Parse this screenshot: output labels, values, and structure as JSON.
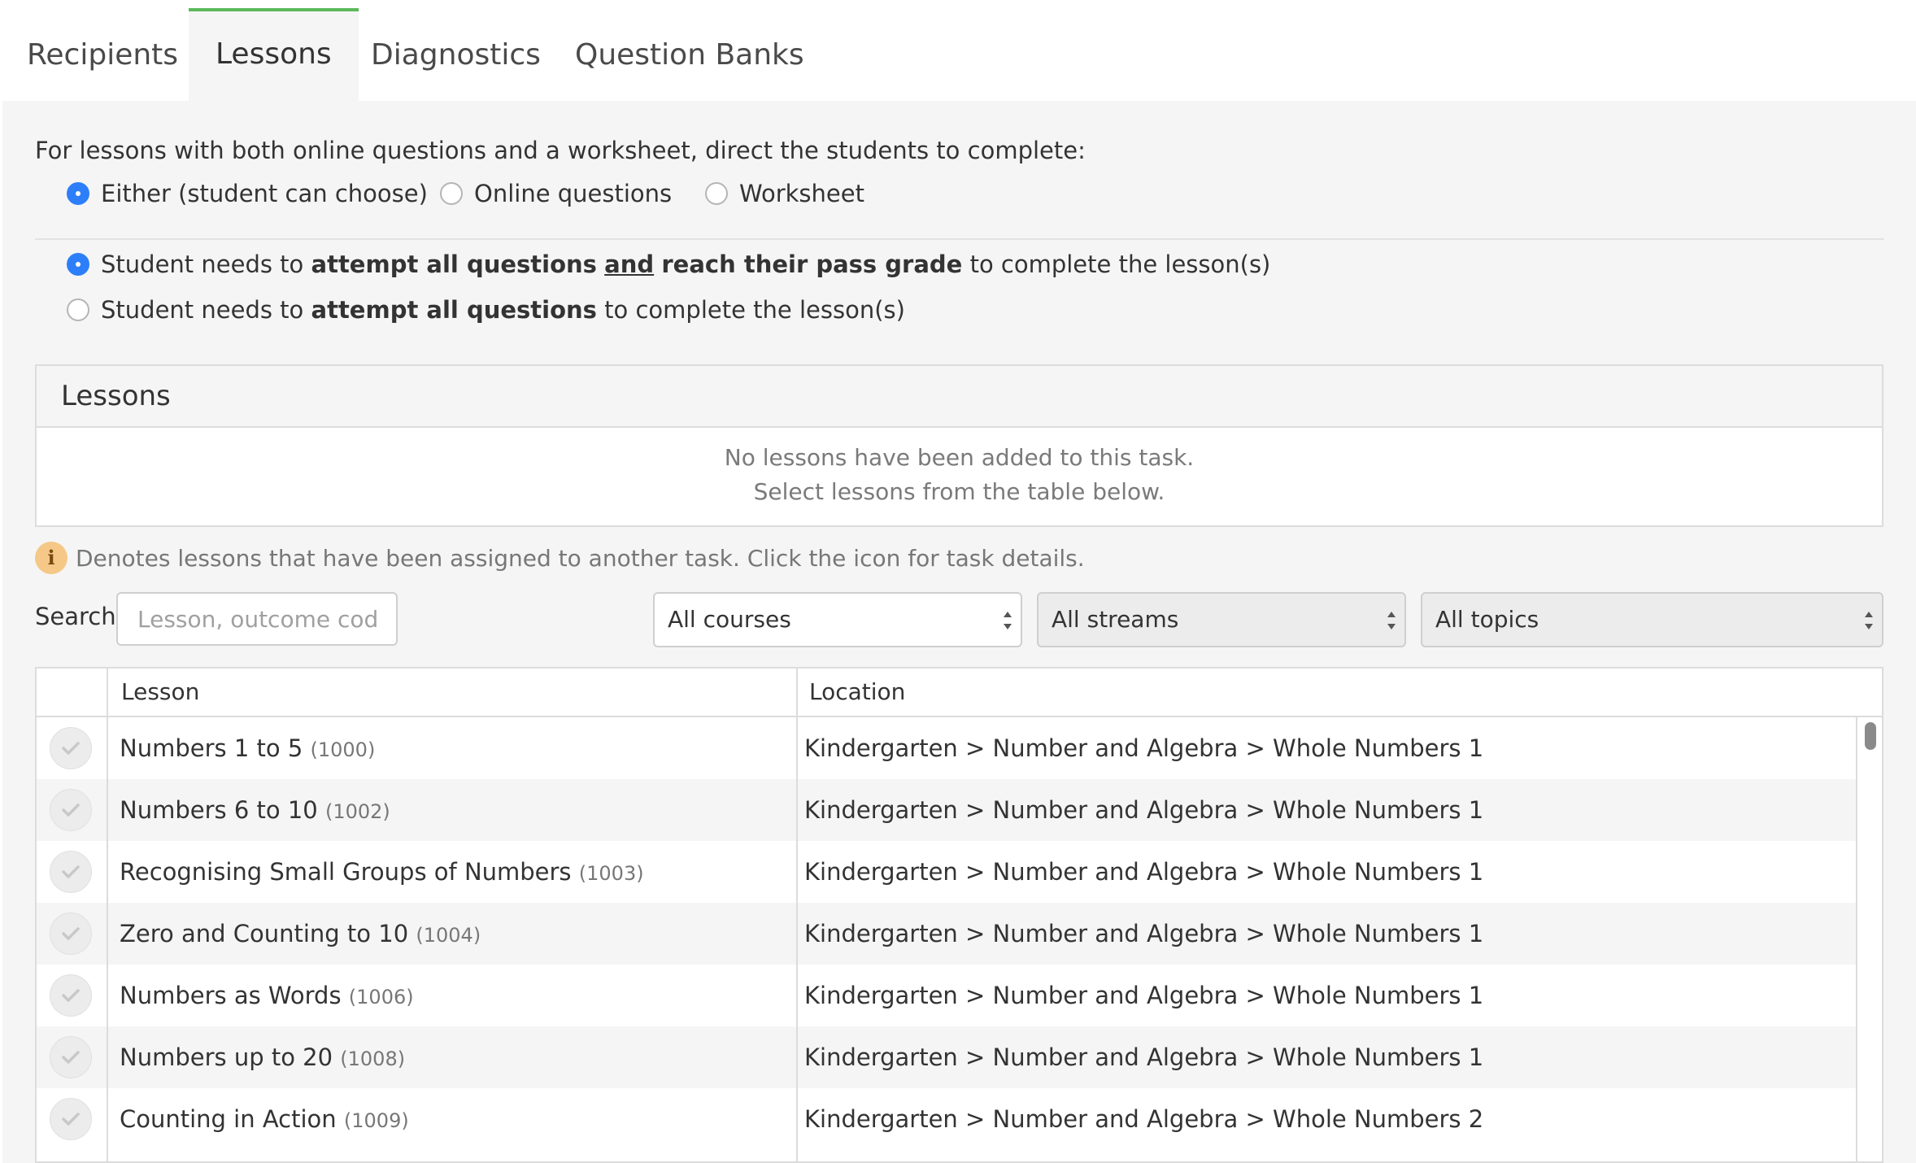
{
  "tabs": [
    {
      "label": "Recipients",
      "active": false
    },
    {
      "label": "Lessons",
      "active": true
    },
    {
      "label": "Diagnostics",
      "active": false
    },
    {
      "label": "Question Banks",
      "active": false
    }
  ],
  "completion": {
    "intro": "For lessons with both online questions and a worksheet, direct the students to complete:",
    "options": [
      {
        "label": "Either (student can choose)",
        "checked": true
      },
      {
        "label": "Online questions",
        "checked": false
      },
      {
        "label": "Worksheet",
        "checked": false
      }
    ]
  },
  "pass_rule": {
    "option1": {
      "prefix": "Student needs to ",
      "bold1": "attempt all questions",
      "and": "and",
      "bold2": "reach their pass grade",
      "suffix": " to complete the lesson(s)",
      "checked": true
    },
    "option2": {
      "prefix": "Student needs to ",
      "bold1": "attempt all questions",
      "suffix": " to complete the lesson(s)",
      "checked": false
    }
  },
  "lessons_box": {
    "title": "Lessons",
    "empty_line1": "No lessons have been added to this task.",
    "empty_line2": "Select lessons from the table below."
  },
  "info_note": {
    "icon": "info-icon",
    "glyph": "i",
    "text": "Denotes lessons that have been assigned to another task. Click the icon for task details."
  },
  "filters": {
    "search_label": "Search",
    "search_placeholder": "Lesson, outcome code,",
    "courses": "All courses",
    "streams": "All streams",
    "topics": "All topics"
  },
  "table": {
    "columns": [
      "Lesson",
      "Location"
    ],
    "rows": [
      {
        "lesson": "Numbers 1 to 5",
        "code": "(1000)",
        "location": "Kindergarten > Number and Algebra > Whole Numbers 1"
      },
      {
        "lesson": "Numbers 6 to 10",
        "code": "(1002)",
        "location": "Kindergarten > Number and Algebra > Whole Numbers 1"
      },
      {
        "lesson": "Recognising Small Groups of Numbers",
        "code": "(1003)",
        "location": "Kindergarten > Number and Algebra > Whole Numbers 1"
      },
      {
        "lesson": "Zero and Counting to 10",
        "code": "(1004)",
        "location": "Kindergarten > Number and Algebra > Whole Numbers 1"
      },
      {
        "lesson": "Numbers as Words",
        "code": "(1006)",
        "location": "Kindergarten > Number and Algebra > Whole Numbers 1"
      },
      {
        "lesson": "Numbers up to 20",
        "code": "(1008)",
        "location": "Kindergarten > Number and Algebra > Whole Numbers 1"
      },
      {
        "lesson": "Counting in Action",
        "code": "(1009)",
        "location": "Kindergarten > Number and Algebra > Whole Numbers 2"
      }
    ]
  },
  "colors": {
    "accent_green": "#5cb85c",
    "radio_blue": "#2d7ff9",
    "info_orange": "#f5c888"
  }
}
